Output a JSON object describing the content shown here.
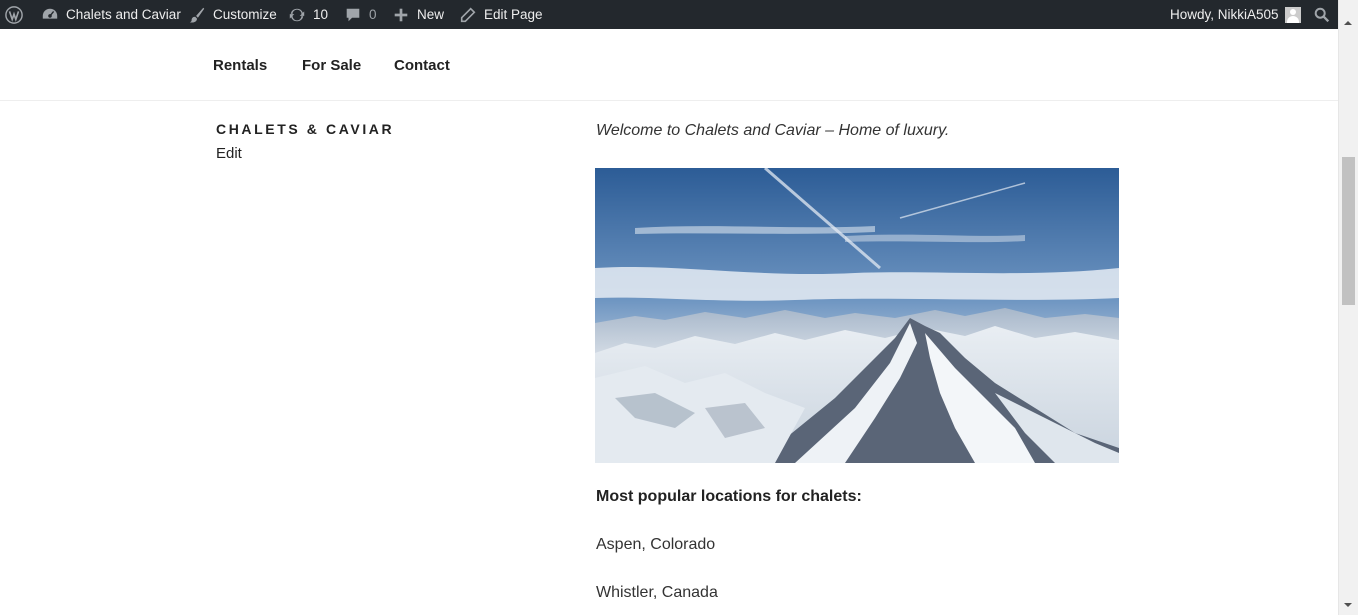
{
  "adminbar": {
    "site_name": "Chalets and Caviar",
    "customize": "Customize",
    "updates_count": "10",
    "comments_count": "0",
    "new_label": "New",
    "edit_page": "Edit Page",
    "howdy": "Howdy, NikkiA505",
    "icons": [
      "wordpress-logo-icon",
      "dashboard-icon",
      "brush-icon",
      "updates-icon",
      "comment-icon",
      "plus-icon",
      "pencil-icon",
      "avatar-icon",
      "search-icon"
    ]
  },
  "nav": {
    "items": [
      {
        "label": "Rentals"
      },
      {
        "label": "For Sale"
      },
      {
        "label": "Contact"
      }
    ]
  },
  "sidebar": {
    "title": "CHALETS & CAVIAR",
    "edit": "Edit"
  },
  "content": {
    "welcome": "Welcome to Chalets and Caviar – Home of luxury.",
    "heading": "Most popular locations for chalets:",
    "locations": [
      "Aspen, Colorado",
      "Whistler, Canada"
    ]
  },
  "colors": {
    "adminbar_bg": "#23282d",
    "text": "#222222",
    "sky_top": "#2c5c96",
    "snow": "#e8edf2"
  }
}
